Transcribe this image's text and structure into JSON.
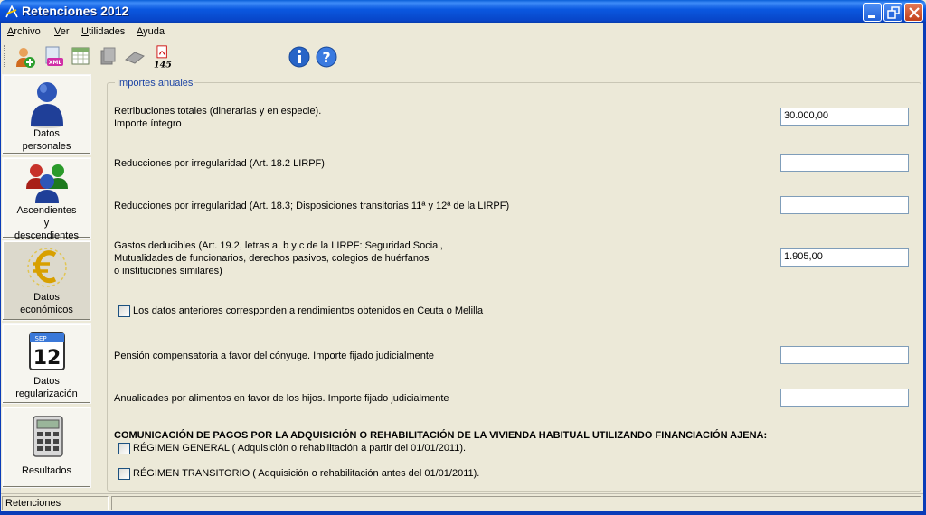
{
  "window": {
    "title": "Retenciones 2012"
  },
  "menu": {
    "items": [
      {
        "mnemonic": "A",
        "rest": "rchivo"
      },
      {
        "mnemonic": "V",
        "rest": "er"
      },
      {
        "mnemonic": "U",
        "rest": "tilidades"
      },
      {
        "mnemonic": "A",
        "rest": "yuda"
      }
    ]
  },
  "toolbar": {
    "icons": [
      "add-user-icon",
      "xml-export-icon",
      "spreadsheet-icon",
      "copy-icon",
      "paste-icon",
      "pdf-145-icon",
      "info-icon",
      "help-icon"
    ],
    "pdf_label": "145"
  },
  "nav": {
    "items": [
      {
        "label_lines": [
          "Datos",
          "personales"
        ],
        "icon": "person-icon"
      },
      {
        "label_lines": [
          "Ascendientes",
          "y",
          "descendientes"
        ],
        "icon": "family-icon"
      },
      {
        "label_lines": [
          "Datos",
          "económicos"
        ],
        "icon": "euro-icon",
        "active": true
      },
      {
        "label_lines": [
          "Datos",
          "regularización"
        ],
        "icon": "calendar-icon",
        "calendar_month": "SEP",
        "calendar_day": "12"
      },
      {
        "label_lines": [
          "Resultados"
        ],
        "icon": "calculator-icon"
      }
    ]
  },
  "main": {
    "group_title": "Importes anuales",
    "fields": [
      {
        "label_lines": [
          "Retribuciones totales (dinerarias y en especie).",
          "Importe íntegro"
        ],
        "value": "30.000,00"
      },
      {
        "label_lines": [
          "Reducciones por irregularidad (Art. 18.2 LIRPF)"
        ],
        "value": ""
      },
      {
        "label_lines": [
          "Reducciones por irregularidad (Art. 18.3; Disposiciones transitorias 11ª y 12ª de la LIRPF)"
        ],
        "value": ""
      },
      {
        "label_lines": [
          "Gastos deducibles (Art. 19.2, letras a, b y c de la LIRPF: Seguridad Social,",
          "Mutualidades de funcionarios, derechos pasivos, colegios de huérfanos",
          "o instituciones similares)"
        ],
        "value": "1.905,00"
      },
      {
        "label_lines": [
          "Pensión compensatoria a favor del cónyuge. Importe fijado judicialmente"
        ],
        "value": ""
      },
      {
        "label_lines": [
          "Anualidades por alimentos en favor de los hijos. Importe fijado judicialmente"
        ],
        "value": ""
      }
    ],
    "ceuta_checkbox": {
      "label": "Los datos anteriores corresponden a rendimientos obtenidos en Ceuta o Melilla",
      "checked": false
    },
    "heading": "COMUNICACIÓN DE PAGOS POR LA ADQUISICIÓN O REHABILITACIÓN DE LA VIVIENDA HABITUAL UTILIZANDO FINANCIACIÓN AJENA:",
    "regimen_general": {
      "label": "RÉGIMEN GENERAL ( Adquisición o rehabilitación a partir del 01/01/2011).",
      "checked": false
    },
    "regimen_transitorio": {
      "label": "RÉGIMEN TRANSITORIO ( Adquisición o rehabilitación antes del 01/01/2011).",
      "checked": false
    }
  },
  "status": {
    "text": "Retenciones",
    "secondary": ""
  }
}
